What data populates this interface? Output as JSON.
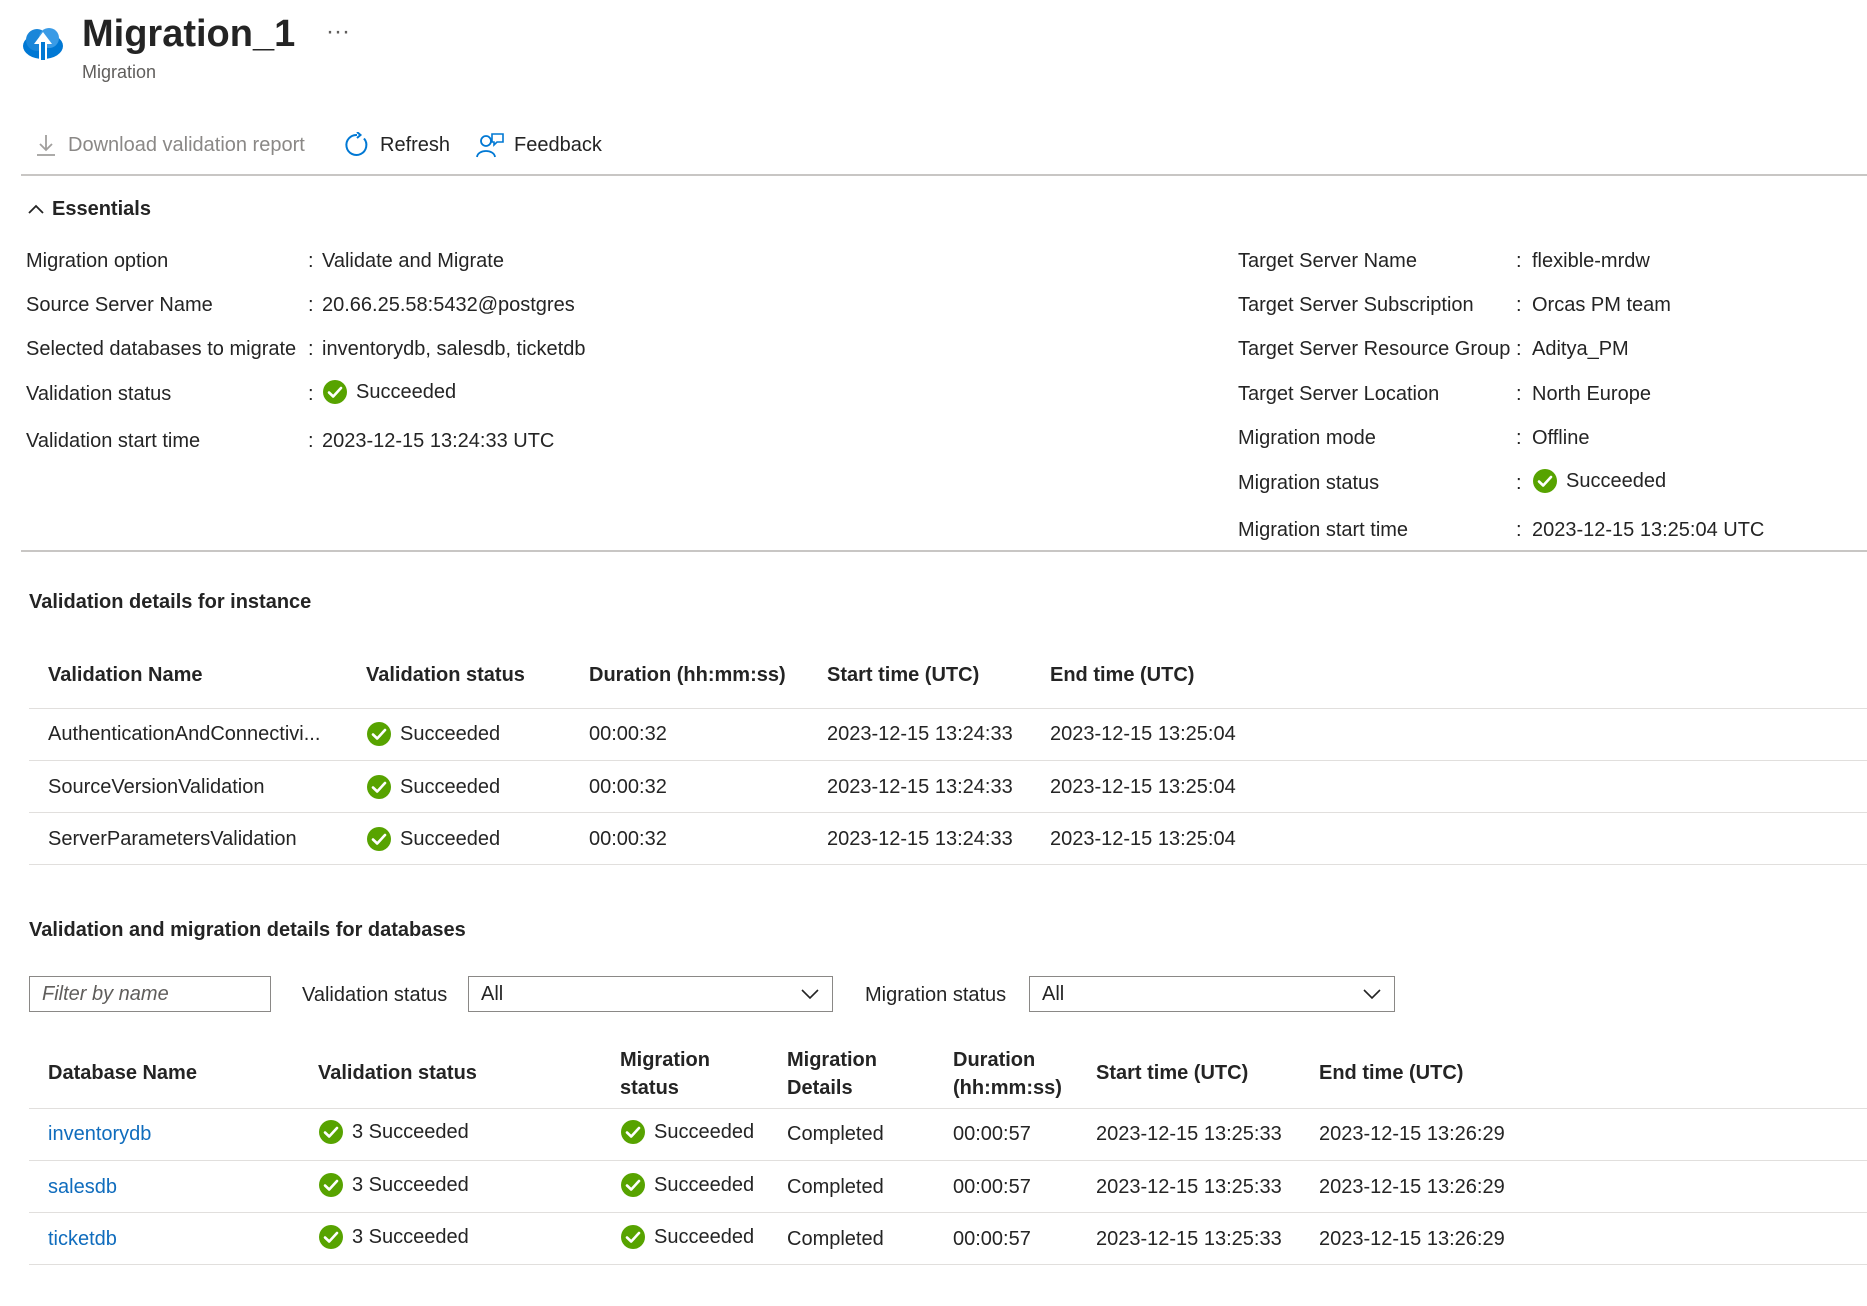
{
  "header": {
    "title": "Migration_1",
    "subtitle": "Migration",
    "more_label": "···",
    "icon": "cloud-upload-icon"
  },
  "toolbar": {
    "download_label": "Download validation report",
    "refresh_label": "Refresh",
    "feedback_label": "Feedback"
  },
  "essentials": {
    "label": "Essentials",
    "left": [
      {
        "label": "Migration option",
        "value": "Validate and Migrate"
      },
      {
        "label": "Source Server Name",
        "value": "20.66.25.58:5432@postgres"
      },
      {
        "label": "Selected databases to migrate",
        "value": "inventorydb, salesdb, ticketdb"
      },
      {
        "label": "Validation status",
        "value": "Succeeded"
      },
      {
        "label": "Validation start time",
        "value": "2023-12-15 13:24:33 UTC"
      }
    ],
    "right": [
      {
        "label": "Target Server Name",
        "value": "flexible-mrdw"
      },
      {
        "label": "Target Server Subscription",
        "value": "Orcas PM team"
      },
      {
        "label": "Target Server Resource Group",
        "value": "Aditya_PM"
      },
      {
        "label": "Target Server Location",
        "value": "North Europe"
      },
      {
        "label": "Migration mode",
        "value": "Offline"
      },
      {
        "label": "Migration status",
        "value": "Succeeded"
      },
      {
        "label": "Migration start time",
        "value": "2023-12-15 13:25:04 UTC"
      }
    ]
  },
  "instance": {
    "title": "Validation details for instance",
    "headers": [
      "Validation Name",
      "Validation status",
      "Duration (hh:mm:ss)",
      "Start time (UTC)",
      "End time (UTC)"
    ],
    "rows": [
      {
        "name": "AuthenticationAndConnectivi...",
        "status": "Succeeded",
        "duration": "00:00:32",
        "start": "2023-12-15 13:24:33",
        "end": "2023-12-15 13:25:04"
      },
      {
        "name": "SourceVersionValidation",
        "status": "Succeeded",
        "duration": "00:00:32",
        "start": "2023-12-15 13:24:33",
        "end": "2023-12-15 13:25:04"
      },
      {
        "name": "ServerParametersValidation",
        "status": "Succeeded",
        "duration": "00:00:32",
        "start": "2023-12-15 13:24:33",
        "end": "2023-12-15 13:25:04"
      }
    ]
  },
  "databases": {
    "title": "Validation and migration details for databases",
    "filter_placeholder": "Filter by name",
    "validation_filter_label": "Validation status",
    "validation_filter_value": "All",
    "migration_filter_label": "Migration status",
    "migration_filter_value": "All",
    "headers": {
      "name": "Database Name",
      "validation": "Validation status",
      "migration_1": "Migration",
      "migration_2": "status",
      "details_1": "Migration",
      "details_2": "Details",
      "duration_1": "Duration",
      "duration_2": "(hh:mm:ss)",
      "start": "Start time (UTC)",
      "end": "End time (UTC)"
    },
    "rows": [
      {
        "name": "inventorydb",
        "validation": "3 Succeeded",
        "migration": "Succeeded",
        "details": "Completed",
        "duration": "00:00:57",
        "start": "2023-12-15 13:25:33",
        "end": "2023-12-15 13:26:29"
      },
      {
        "name": "salesdb",
        "validation": "3 Succeeded",
        "migration": "Succeeded",
        "details": "Completed",
        "duration": "00:00:57",
        "start": "2023-12-15 13:25:33",
        "end": "2023-12-15 13:26:29"
      },
      {
        "name": "ticketdb",
        "validation": "3 Succeeded",
        "migration": "Succeeded",
        "details": "Completed",
        "duration": "00:00:57",
        "start": "2023-12-15 13:25:33",
        "end": "2023-12-15 13:26:29"
      }
    ]
  },
  "colors": {
    "success": "#57a300",
    "link": "#0f6cbd",
    "accent": "#0078d4"
  }
}
